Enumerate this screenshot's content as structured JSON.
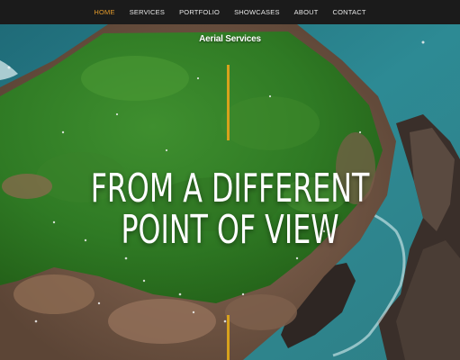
{
  "nav": {
    "items": [
      {
        "label": "HOME",
        "active": true
      },
      {
        "label": "SERVICES",
        "active": false
      },
      {
        "label": "PORTFOLIO",
        "active": false
      },
      {
        "label": "SHOWCASES",
        "active": false
      },
      {
        "label": "ABOUT",
        "active": false
      },
      {
        "label": "CONTACT",
        "active": false
      }
    ],
    "active_color": "#e29a2b",
    "text_color": "#e6e6e6",
    "background": "#1b1b1b"
  },
  "hero": {
    "subtitle": "Aerial Services",
    "headline_line1": "FROM A DIFFERENT",
    "headline_line2": "POINT OF VIEW",
    "accent_color": "#d7a11c"
  }
}
